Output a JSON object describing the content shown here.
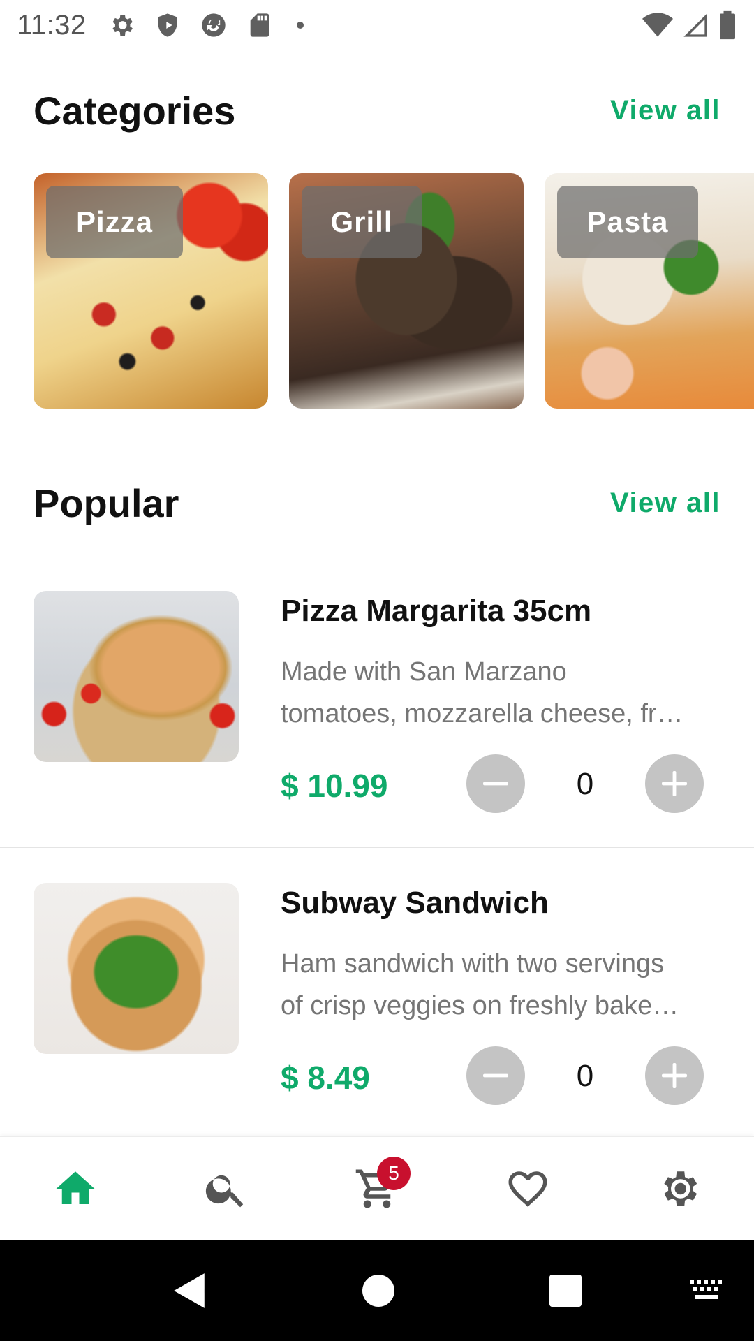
{
  "status_bar": {
    "time": "11:32",
    "left_icons": [
      "gear-icon",
      "shield-icon",
      "sync-icon",
      "sd-card-icon",
      "dot-icon"
    ],
    "right_icons": [
      "wifi-icon",
      "signal-icon",
      "battery-icon"
    ]
  },
  "categories": {
    "title": "Categories",
    "view_all": "View all",
    "items": [
      {
        "label": "Pizza"
      },
      {
        "label": "Grill"
      },
      {
        "label": "Pasta"
      }
    ]
  },
  "popular": {
    "title": "Popular",
    "view_all": "View all",
    "items": [
      {
        "name": "Pizza Margarita 35cm",
        "desc_line1": "Made with San Marzano",
        "desc_line2": "tomatoes, mozzarella cheese, fr…",
        "price": "$ 10.99",
        "quantity": "0"
      },
      {
        "name": "Subway Sandwich",
        "desc_line1": "Ham sandwich with two servings",
        "desc_line2": "of crisp veggies on freshly bake…",
        "price": "$ 8.49",
        "quantity": "0"
      }
    ]
  },
  "bottom_nav": {
    "items": [
      "home-icon",
      "search-icon",
      "cart-icon",
      "favorite-icon",
      "settings-icon"
    ],
    "active": "home",
    "cart_count": "5"
  },
  "colors": {
    "accent": "#0faa6a",
    "badge": "#c8102e",
    "button_disabled": "#c4c4c4"
  }
}
